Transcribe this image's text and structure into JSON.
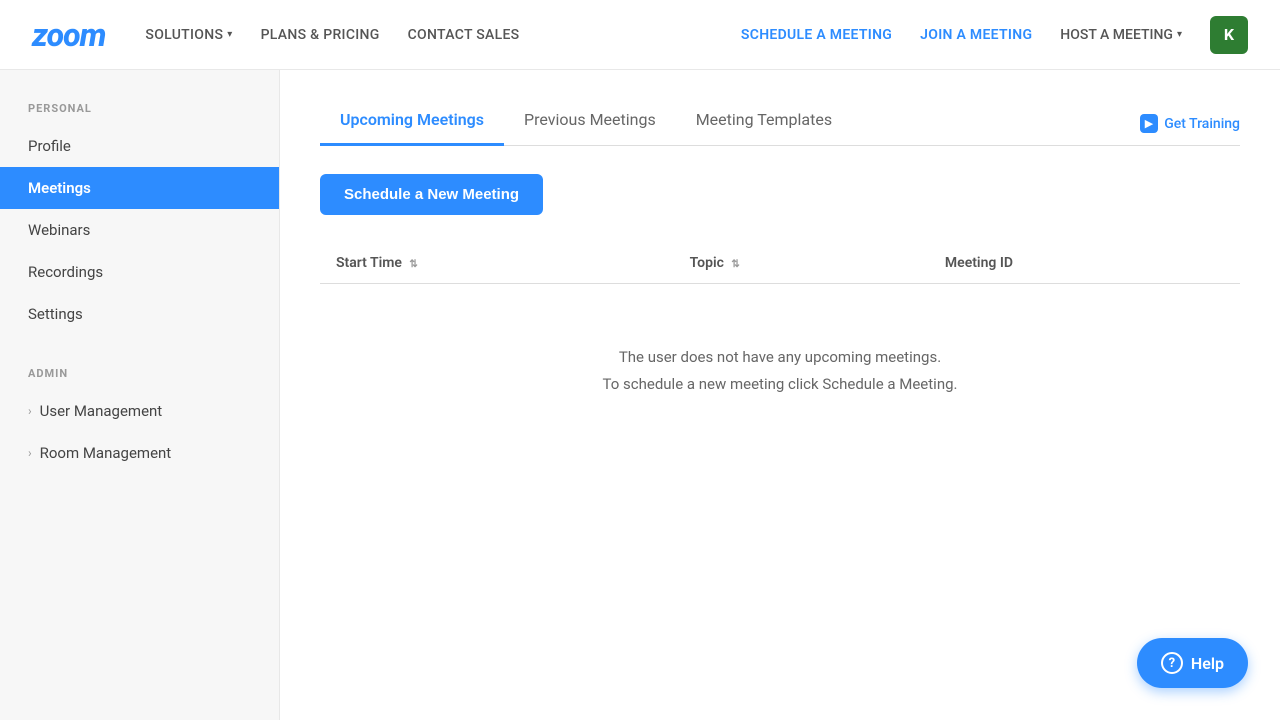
{
  "header": {
    "logo": "zoom",
    "nav_left": [
      {
        "label": "SOLUTIONS",
        "has_dropdown": true
      },
      {
        "label": "PLANS & PRICING",
        "has_dropdown": false
      },
      {
        "label": "CONTACT SALES",
        "has_dropdown": false
      }
    ],
    "nav_right": [
      {
        "label": "SCHEDULE A MEETING"
      },
      {
        "label": "JOIN A MEETING"
      },
      {
        "label": "HOST A MEETING",
        "has_dropdown": true
      }
    ],
    "avatar_letter": "K"
  },
  "sidebar": {
    "personal_label": "PERSONAL",
    "personal_items": [
      {
        "label": "Profile",
        "active": false
      },
      {
        "label": "Meetings",
        "active": true
      },
      {
        "label": "Webinars",
        "active": false
      },
      {
        "label": "Recordings",
        "active": false
      },
      {
        "label": "Settings",
        "active": false
      }
    ],
    "admin_label": "ADMIN",
    "admin_items": [
      {
        "label": "User Management"
      },
      {
        "label": "Room Management"
      }
    ]
  },
  "main": {
    "tabs": [
      {
        "label": "Upcoming Meetings",
        "active": true
      },
      {
        "label": "Previous Meetings",
        "active": false
      },
      {
        "label": "Meeting Templates",
        "active": false
      }
    ],
    "get_training_label": "Get Training",
    "schedule_btn_label": "Schedule a New Meeting",
    "table": {
      "columns": [
        {
          "label": "Start Time",
          "sortable": true
        },
        {
          "label": "Topic",
          "sortable": true
        },
        {
          "label": "Meeting ID",
          "sortable": false
        }
      ]
    },
    "empty_state_line1": "The user does not have any upcoming meetings.",
    "empty_state_line2": "To schedule a new meeting click Schedule a Meeting."
  },
  "help": {
    "label": "Help"
  }
}
